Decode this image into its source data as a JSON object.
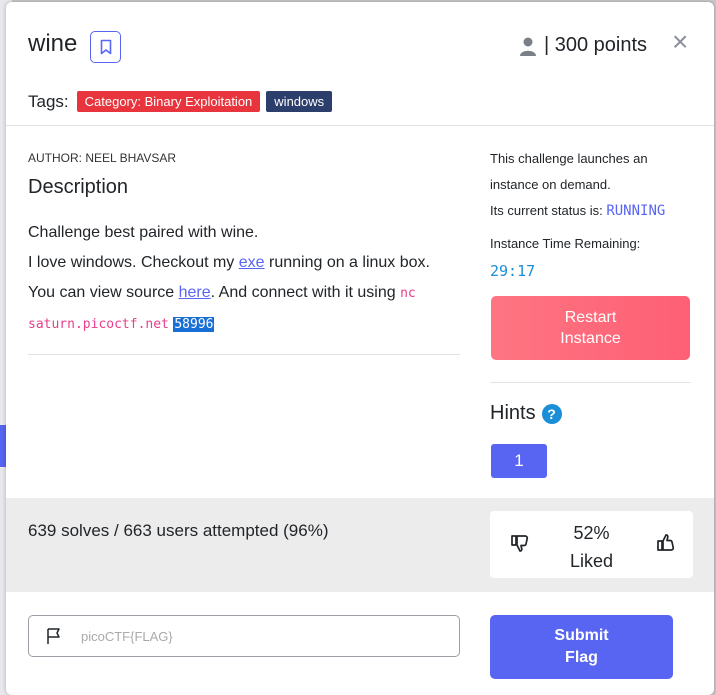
{
  "challenge": {
    "title": "wine",
    "points": "| 300 points",
    "close": "×"
  },
  "tags": {
    "label": "Tags:",
    "category": "Category: Binary Exploitation",
    "platform": "windows"
  },
  "description": {
    "author": "AUTHOR: NEEL BHAVSAR",
    "heading": "Description",
    "line1": "Challenge best paired with wine.",
    "line2_pre": "I love windows. Checkout my ",
    "line2_link": "exe",
    "line2_post": " running on a linux box.",
    "line3_pre": "You can view source ",
    "line3_link": "here",
    "line3_post": ". And connect with it using ",
    "cmd_nc": "nc",
    "cmd_host": "saturn.picoctf.net",
    "cmd_port": "58996"
  },
  "instance": {
    "line1": "This challenge launches an instance on demand.",
    "status_label": "Its current status is: ",
    "status_value": "RUNNING",
    "remaining_label": "Instance Time Remaining:",
    "remaining_value": "29:17",
    "restart_line1": "Restart",
    "restart_line2": "Instance"
  },
  "hints": {
    "heading": "Hints",
    "help_glyph": "?",
    "items": [
      "1"
    ]
  },
  "stats": {
    "solves": "639 solves / 663 users attempted (96%)",
    "liked_percent": "52%",
    "liked_label": "Liked"
  },
  "flag": {
    "placeholder": "picoCTF{FLAG}",
    "submit_line1": "Submit",
    "submit_line2": "Flag"
  },
  "colors": {
    "accent": "#5865f2",
    "restart": "#fe6b7b",
    "category_tag": "#e8343c",
    "windows_tag": "#2c3e6b",
    "timer": "#1a8fd8"
  }
}
